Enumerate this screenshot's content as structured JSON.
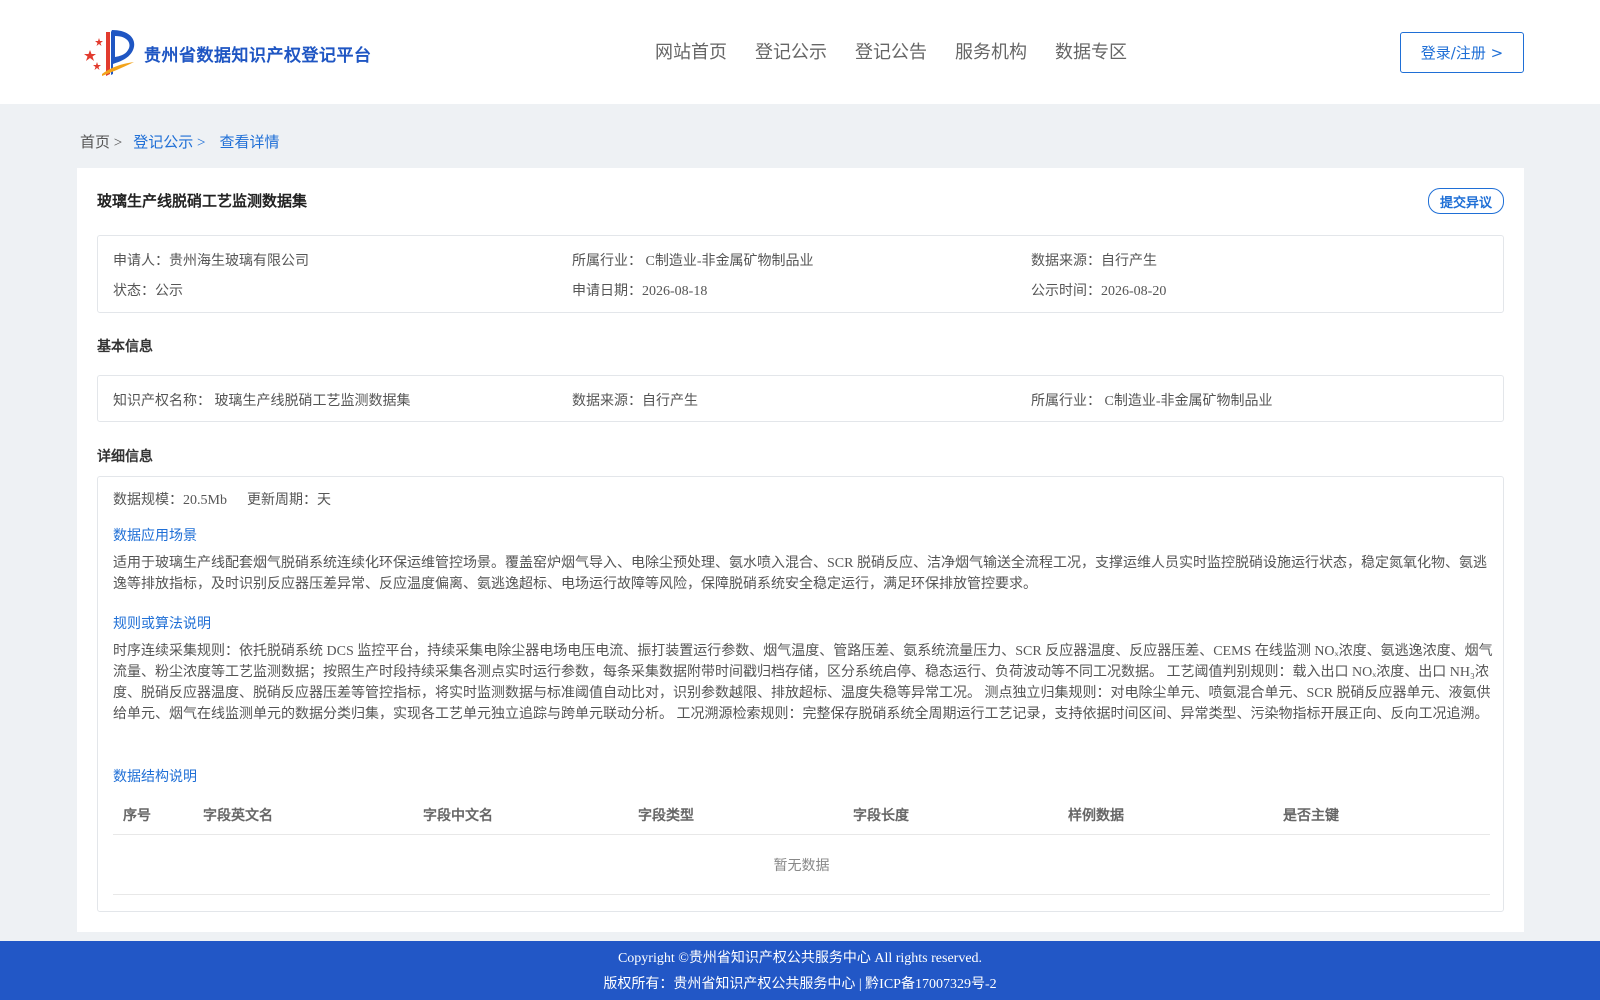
{
  "header": {
    "logo_text": "贵州省数据知识产权登记平台",
    "nav": [
      "网站首页",
      "登记公示",
      "登记公告",
      "服务机构",
      "数据专区"
    ],
    "login_label": "登录/注册 >"
  },
  "breadcrumb": {
    "home": "首页 >",
    "link": "登记公示 >",
    "current": "查看详情"
  },
  "detail": {
    "title": "玻璃生产线脱硝工艺监测数据集",
    "objection_label": "提交异议",
    "summary": {
      "applicant": "申请人：贵州海生玻璃有限公司",
      "industry": "所属行业： C制造业-非金属矿物制品业",
      "source": "数据来源：自行产生",
      "status": "状态：公示",
      "apply_date": "申请日期：2026-08-18",
      "publish_time": "公示时间：2026-08-20"
    },
    "basic_heading": "基本信息",
    "basic": {
      "ip_name": "知识产权名称： 玻璃生产线脱硝工艺监测数据集",
      "source": "数据来源：自行产生",
      "industry": "所属行业： C制造业-非金属矿物制品业"
    },
    "detail_heading": "详细信息",
    "scale": "数据规模：20.5Mb",
    "update_cycle": "更新周期：天",
    "scenario_heading": "数据应用场景",
    "scenario_text": "适用于玻璃生产线配套烟气脱硝系统连续化环保运维管控场景。覆盖窑炉烟气导入、电除尘预处理、氨水喷入混合、SCR 脱硝反应、洁净烟气输送全流程工况，支撑运维人员实时监控脱硝设施运行状态，稳定氮氧化物、氨逃逸等排放指标，及时识别反应器压差异常、反应温度偏离、氨逃逸超标、电场运行故障等风险，保障脱硝系统安全稳定运行，满足环保排放管控要求。",
    "rules_heading": "规则或算法说明",
    "rules_text": "时序连续采集规则：依托脱硝系统 DCS 监控平台，持续采集电除尘器电场电压电流、振打装置运行参数、烟气温度、管路压差、氨系统流量压力、SCR 反应器温度、反应器压差、CEMS 在线监测 NOₓ浓度、氨逃逸浓度、烟气流量、粉尘浓度等工艺监测数据；按照生产时段持续采集各测点实时运行参数，每条采集数据附带时间戳归档存储，区分系统启停、稳态运行、负荷波动等不同工况数据。 工艺阈值判别规则：载入出口 NOₓ浓度、出口 NH₃浓度、脱硝反应器温度、脱硝反应器压差等管控指标，将实时监测数据与标准阈值自动比对，识别参数越限、排放超标、温度失稳等异常工况。 测点独立归集规则：对电除尘单元、喷氨混合单元、SCR 脱硝反应器单元、液氨供给单元、烟气在线监测单元的数据分类归集，实现各工艺单元独立追踪与跨单元联动分析。 工况溯源检索规则：完整保存脱硝系统全周期运行工艺记录，支持依据时间区间、异常类型、污染物指标开展正向、反向工况追溯。",
    "structure_heading": "数据结构说明",
    "table_headers": [
      "序号",
      "字段英文名",
      "字段中文名",
      "字段类型",
      "字段长度",
      "样例数据",
      "是否主键"
    ],
    "table_empty": "暂无数据"
  },
  "footer": {
    "copyright": "Copyright ©贵州省知识产权公共服务中心 All rights reserved.",
    "record": "版权所有：贵州省知识产权公共服务中心 | 黔ICP备17007329号-2"
  }
}
